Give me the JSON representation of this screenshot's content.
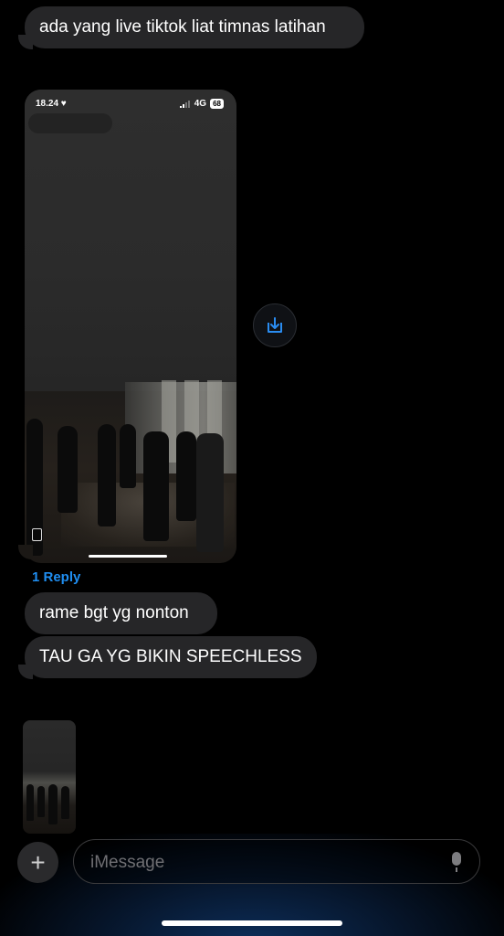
{
  "messages": {
    "m1": "ada yang live tiktok liat timnas latihan",
    "m2": "rame bgt yg nonton",
    "m3": "TAU GA YG BIKIN SPEECHLESS"
  },
  "media": {
    "status_time": "18.24 ♥",
    "network": "4G",
    "battery": "68"
  },
  "thread": {
    "reply_label": "1 Reply"
  },
  "composer": {
    "placeholder": "iMessage",
    "plus": "+"
  },
  "colors": {
    "accent": "#1f8ef1",
    "bubble": "#262628",
    "background": "#000000"
  }
}
